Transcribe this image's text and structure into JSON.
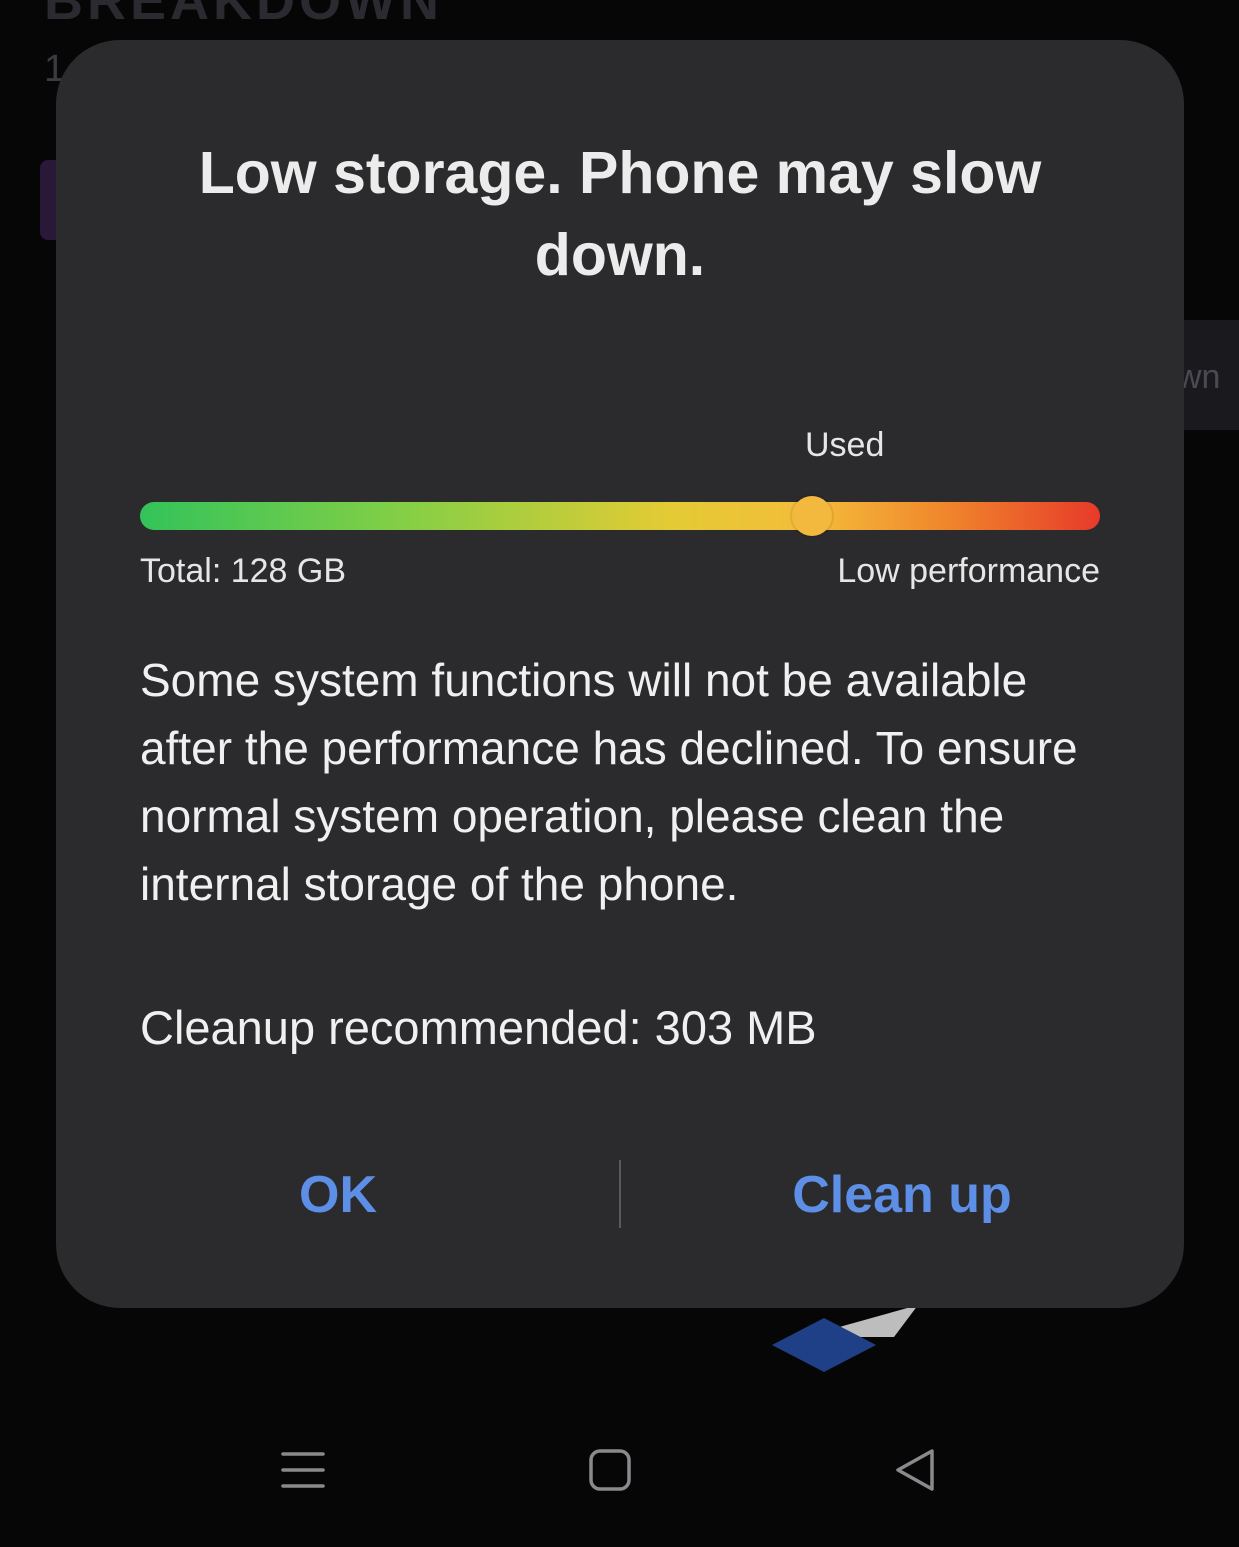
{
  "dialog": {
    "title": "Low storage. Phone may slow down.",
    "storage_bar": {
      "used_label": "Used",
      "total_label": "Total: 128 GB",
      "low_performance_label": "Low performance",
      "used_fraction": 0.7,
      "gradient_colors": [
        "#33c35a",
        "#86cf45",
        "#e3cb34",
        "#f4bc3a",
        "#f0862c",
        "#e73a2a"
      ]
    },
    "message": "Some system functions will not be available after the performance has declined. To ensure normal system operation, please clean the internal storage of the phone.",
    "cleanup_recommended": "Cleanup recommended: 303 MB",
    "buttons": {
      "ok_label": "OK",
      "clean_up_label": "Clean up"
    },
    "accent_color": "#5e8fe6",
    "background_color": "#2b2b2d"
  },
  "navigation_bar": {
    "icons": [
      "menu-icon",
      "home-icon",
      "back-icon"
    ]
  }
}
